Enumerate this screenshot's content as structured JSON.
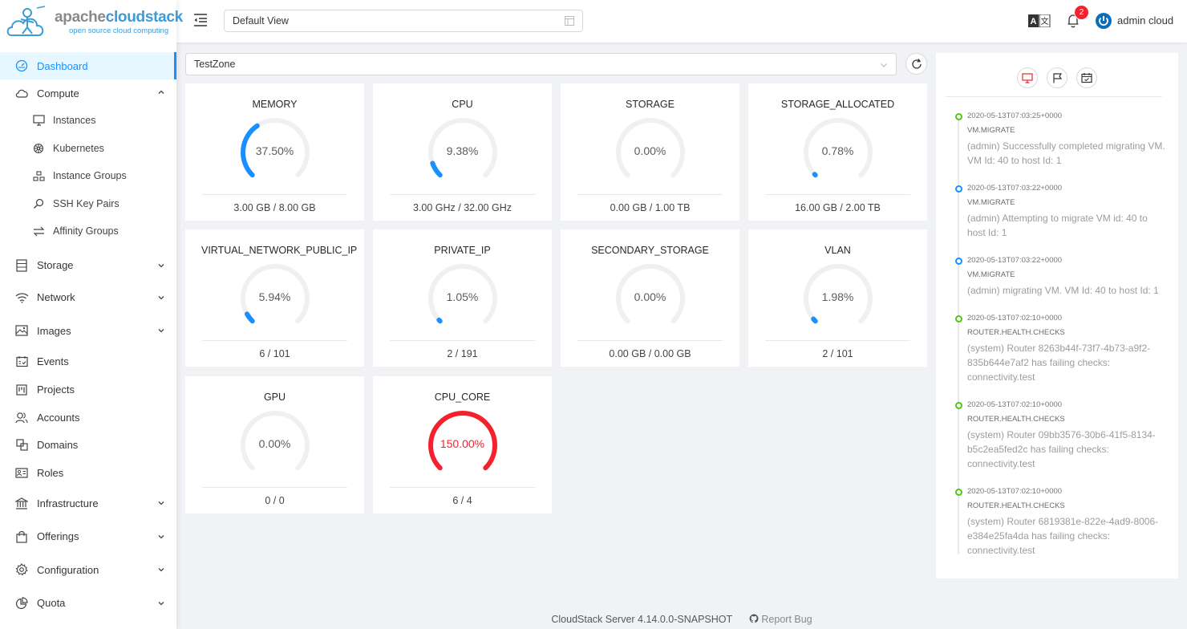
{
  "brand": {
    "name_prefix": "apache",
    "name_suffix": "cloudstack",
    "tagline": "open source cloud computing"
  },
  "header": {
    "view_select": "Default View",
    "notification_count": "2",
    "user_name": "admin cloud"
  },
  "sidebar": {
    "items": [
      {
        "label": "Dashboard",
        "icon": "dashboard-icon",
        "active": true
      },
      {
        "label": "Compute",
        "icon": "cloud-icon",
        "expanded": true
      },
      {
        "label": "Storage",
        "icon": "database-icon"
      },
      {
        "label": "Network",
        "icon": "wifi-icon"
      },
      {
        "label": "Images",
        "icon": "picture-icon"
      },
      {
        "label": "Events",
        "icon": "schedule-icon"
      },
      {
        "label": "Projects",
        "icon": "project-icon"
      },
      {
        "label": "Accounts",
        "icon": "team-icon"
      },
      {
        "label": "Domains",
        "icon": "block-icon"
      },
      {
        "label": "Roles",
        "icon": "idcard-icon"
      },
      {
        "label": "Infrastructure",
        "icon": "bank-icon"
      },
      {
        "label": "Offerings",
        "icon": "shopping-icon"
      },
      {
        "label": "Configuration",
        "icon": "setting-icon"
      },
      {
        "label": "Quota",
        "icon": "pie-chart-icon"
      }
    ],
    "compute_children": [
      {
        "label": "Instances",
        "icon": "desktop-icon"
      },
      {
        "label": "Kubernetes",
        "icon": "kubernetes-icon"
      },
      {
        "label": "Instance Groups",
        "icon": "gold-icon"
      },
      {
        "label": "SSH Key Pairs",
        "icon": "key-icon"
      },
      {
        "label": "Affinity Groups",
        "icon": "swap-icon"
      }
    ]
  },
  "zone_select": "TestZone",
  "capacity": [
    {
      "title": "MEMORY",
      "percent_text": "37.50%",
      "percent": 37.5,
      "detail": "3.00 GB / 8.00 GB"
    },
    {
      "title": "CPU",
      "percent_text": "9.38%",
      "percent": 9.38,
      "detail": "3.00 GHz / 32.00 GHz"
    },
    {
      "title": "STORAGE",
      "percent_text": "0.00%",
      "percent": 0,
      "detail": "0.00 GB / 1.00 TB"
    },
    {
      "title": "STORAGE_ALLOCATED",
      "percent_text": "0.78%",
      "percent": 0.78,
      "detail": "16.00 GB / 2.00 TB"
    },
    {
      "title": "VIRTUAL_NETWORK_PUBLIC_IP",
      "percent_text": "5.94%",
      "percent": 5.94,
      "detail": "6 / 101"
    },
    {
      "title": "PRIVATE_IP",
      "percent_text": "1.05%",
      "percent": 1.05,
      "detail": "2 / 191"
    },
    {
      "title": "SECONDARY_STORAGE",
      "percent_text": "0.00%",
      "percent": 0,
      "detail": "0.00 GB / 0.00 GB"
    },
    {
      "title": "VLAN",
      "percent_text": "1.98%",
      "percent": 1.98,
      "detail": "2 / 101"
    },
    {
      "title": "GPU",
      "percent_text": "0.00%",
      "percent": 0,
      "detail": "0 / 0"
    },
    {
      "title": "CPU_CORE",
      "percent_text": "150.00%",
      "percent": 150,
      "detail": "6 / 4"
    }
  ],
  "colors": {
    "normal": "#1890ff",
    "exceeded": "#f5222d",
    "track": "#f0f0f0"
  },
  "events": [
    {
      "time": "2020-05-13T07:03:25+0000",
      "type": "VM.MIGRATE",
      "desc": "(admin) Successfully completed migrating VM. VM Id: 40 to host Id: 1",
      "status": "green"
    },
    {
      "time": "2020-05-13T07:03:22+0000",
      "type": "VM.MIGRATE",
      "desc": "(admin) Attempting to migrate VM id: 40 to host Id: 1",
      "status": "blue"
    },
    {
      "time": "2020-05-13T07:03:22+0000",
      "type": "VM.MIGRATE",
      "desc": "(admin) migrating VM. VM Id: 40 to host Id: 1",
      "status": "blue"
    },
    {
      "time": "2020-05-13T07:02:10+0000",
      "type": "ROUTER.HEALTH.CHECKS",
      "desc": "(system) Router 8263b44f-73f7-4b73-a9f2-835b644e7af2 has failing checks: connectivity.test",
      "status": "green"
    },
    {
      "time": "2020-05-13T07:02:10+0000",
      "type": "ROUTER.HEALTH.CHECKS",
      "desc": "(system) Router 09bb3576-30b6-41f5-8134-b5c2ea5fed2c has failing checks: connectivity.test",
      "status": "green"
    },
    {
      "time": "2020-05-13T07:02:10+0000",
      "type": "ROUTER.HEALTH.CHECKS",
      "desc": "(system) Router 6819381e-822e-4ad9-8006-e384e25fa4da has failing checks: connectivity.test",
      "status": "green"
    }
  ],
  "footer": {
    "version": "CloudStack Server 4.14.0.0-SNAPSHOT",
    "report_bug": "Report Bug"
  }
}
